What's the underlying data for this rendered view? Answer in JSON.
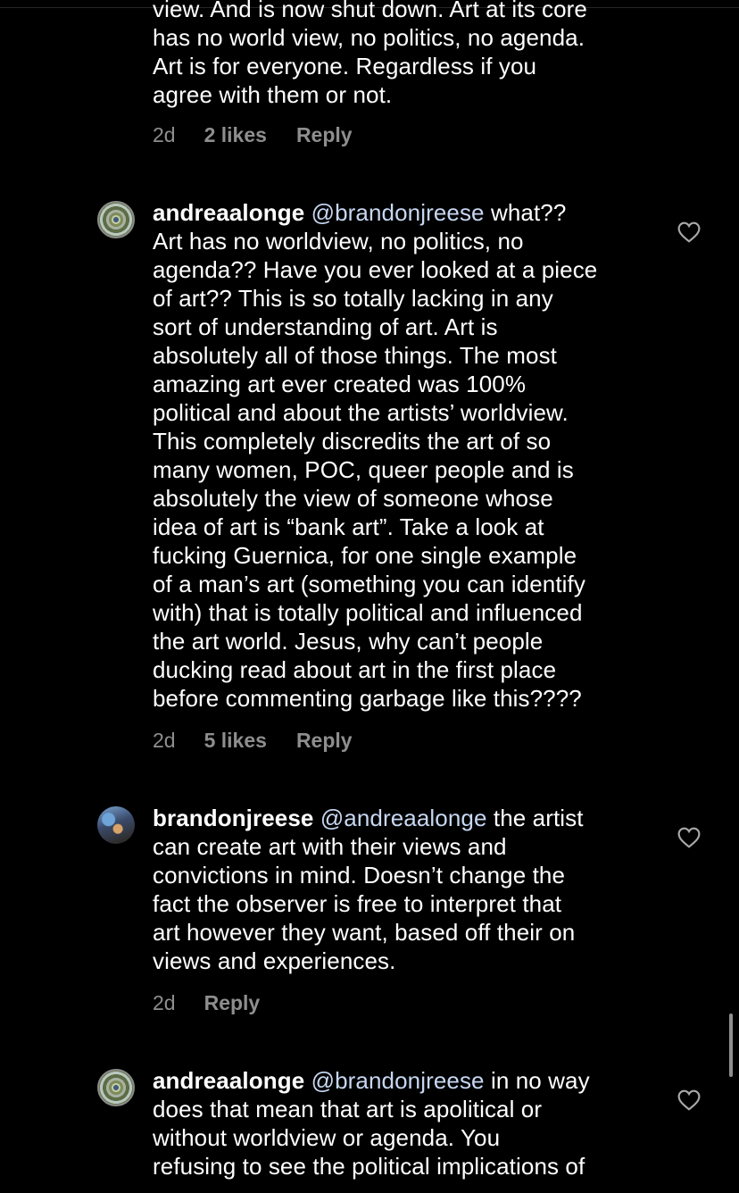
{
  "top_comment": {
    "lines": [
      "view. And is now shut down. Art at its core",
      "has no world view, no politics, no agenda.",
      "Art is for everyone. Regardless if you",
      "agree with them or not."
    ],
    "time": "2d",
    "likes": "2 likes",
    "reply_label": "Reply"
  },
  "comments": [
    {
      "username": "andreaalonge",
      "mention": "@brandonjreese",
      "first_line_rest": " what??",
      "lines": [
        "Art has no worldview, no politics, no",
        "agenda?? Have you ever looked at a piece",
        "of art?? This is so totally lacking in any",
        "sort of understanding of art. Art is",
        "absolutely all of those things. The most",
        "amazing art ever created was 100%",
        "political and about the artists’ worldview.",
        "This completely discredits the art of so",
        "many women, POC, queer people and is",
        "absolutely the view of someone whose",
        "idea of art is “bank art”. Take a look at",
        "fucking Guernica, for one single example",
        "of a man’s art (something you can identify",
        "with) that is totally political and influenced",
        "the art world. Jesus, why can’t people",
        "ducking read about art in the first place",
        "before commenting garbage like this????"
      ],
      "time": "2d",
      "likes": "5 likes",
      "reply_label": "Reply"
    },
    {
      "username": "brandonjreese",
      "mention": "@andreaalonge",
      "first_line_rest": " the artist",
      "lines": [
        "can create  art with their views and",
        "convictions in mind. Doesn’t change the",
        "fact the observer is free to interpret that",
        "art however they want, based off their on",
        "views and experiences."
      ],
      "time": "2d",
      "reply_label": "Reply"
    },
    {
      "username": "andreaalonge",
      "mention": "@brandonjreese",
      "first_line_rest": " in no way",
      "lines": [
        "does that mean that art is apolitical or",
        "without worldview or agenda. You",
        "refusing to see the political implications of"
      ]
    }
  ],
  "icons": {
    "like": "heart-outline-icon",
    "avatar_andrea": "swirl-avatar",
    "avatar_brandon": "photo-avatar"
  },
  "colors": {
    "background": "#000000",
    "text": "#ffffff",
    "secondary": "#8e8e8e",
    "mention": "#c7d7f2"
  }
}
